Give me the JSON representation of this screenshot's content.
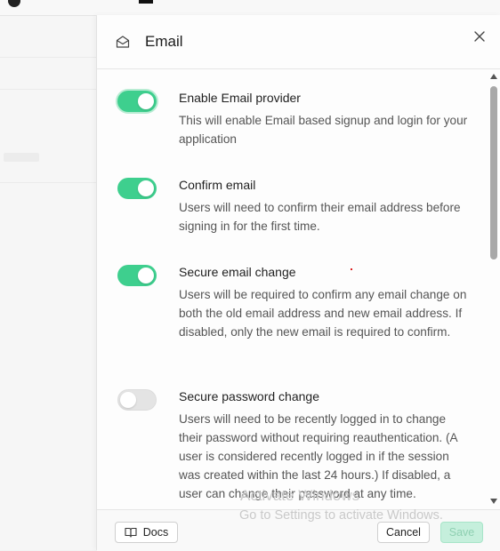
{
  "panel": {
    "title": "Email",
    "icon": "mail-open-icon",
    "close_icon": "close-icon"
  },
  "settings": [
    {
      "label": "Enable Email provider",
      "description": "This will enable Email based signup and login for your application",
      "enabled": true
    },
    {
      "label": "Confirm email",
      "description": "Users will need to confirm their email address before signing in for the first time.",
      "enabled": true
    },
    {
      "label": "Secure email change",
      "description": "Users will be required to confirm any email change on both the old email address and new email address. If disabled, only the new email is required to confirm.",
      "enabled": true
    },
    {
      "label": "Secure password change",
      "description": "Users will need to be recently logged in to change their password without requiring reauthentication. (A user is considered recently logged in if the session was created within the last 24 hours.) If disabled, a user can change their password at any time.",
      "enabled": false
    }
  ],
  "footer": {
    "docs_label": "Docs",
    "cancel_label": "Cancel",
    "save_label": "Save"
  },
  "watermark": {
    "line1": "Activate Windows",
    "line2": "Go to Settings to activate Windows."
  },
  "colors": {
    "accent": "#3ecf8e",
    "toggle_off": "#e4e4e4"
  }
}
